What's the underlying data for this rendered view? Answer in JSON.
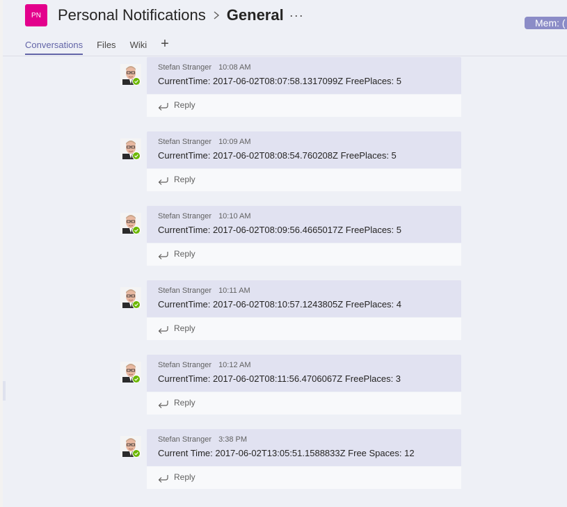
{
  "header": {
    "team_initials": "PN",
    "team_name": "Personal Notifications",
    "channel_name": "General",
    "more_label": "···",
    "members_label": "Mem: ("
  },
  "tabs": [
    {
      "label": "Conversations",
      "active": true
    },
    {
      "label": "Files",
      "active": false
    },
    {
      "label": "Wiki",
      "active": false
    }
  ],
  "add_tab_label": "+",
  "reply_label": "Reply",
  "messages": [
    {
      "author": "Stefan Stranger",
      "time": "10:08 AM",
      "text": "CurrentTime: 2017-06-02T08:07:58.1317099Z FreePlaces: 5"
    },
    {
      "author": "Stefan Stranger",
      "time": "10:09 AM",
      "text": "CurrentTime: 2017-06-02T08:08:54.760208Z FreePlaces: 5"
    },
    {
      "author": "Stefan Stranger",
      "time": "10:10 AM",
      "text": "CurrentTime: 2017-06-02T08:09:56.4665017Z FreePlaces: 5"
    },
    {
      "author": "Stefan Stranger",
      "time": "10:11 AM",
      "text": "CurrentTime: 2017-06-02T08:10:57.1243805Z FreePlaces: 4"
    },
    {
      "author": "Stefan Stranger",
      "time": "10:12 AM",
      "text": "CurrentTime: 2017-06-02T08:11:56.4706067Z FreePlaces: 3"
    },
    {
      "author": "Stefan Stranger",
      "time": "3:38 PM",
      "text": "Current Time: 2017-06-02T13:05:51.1588833Z Free Spaces: 12"
    }
  ],
  "colors": {
    "accent": "#6264a7",
    "team_avatar": "#e3008c",
    "presence_available": "#6bb700",
    "message_card": "#e1e2f1",
    "background": "#eef0f6"
  }
}
